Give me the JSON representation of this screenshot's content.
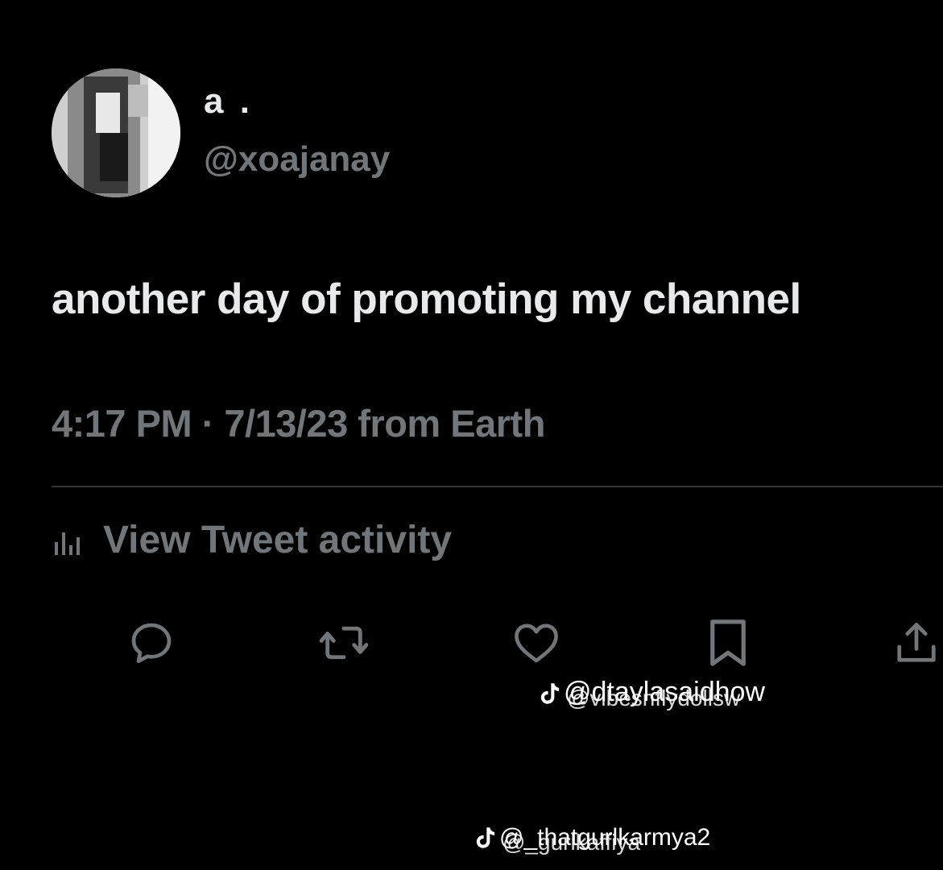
{
  "author": {
    "display_name": "a .",
    "handle": "@xoajanay"
  },
  "tweet": {
    "text": "another day of promoting my channel",
    "timestamp": "4:17 PM · 7/13/23 from Earth"
  },
  "activity": {
    "label": "View Tweet activity"
  },
  "actions": {
    "reply_icon": "reply-icon",
    "retweet_icon": "retweet-icon",
    "like_icon": "heart-icon",
    "bookmark_icon": "bookmark-icon",
    "share_icon": "share-icon"
  },
  "watermarks": {
    "upper_a": "@dtaylasaidhow",
    "upper_b": "@vibesnflydollsw",
    "lower_a": "@_thatgurlkarmya2",
    "lower_b": "@_gurlkaffiya"
  },
  "colors": {
    "background": "#000000",
    "primary_text": "#e7e9ea",
    "secondary_text": "#71767b",
    "divider": "#2f3336"
  }
}
